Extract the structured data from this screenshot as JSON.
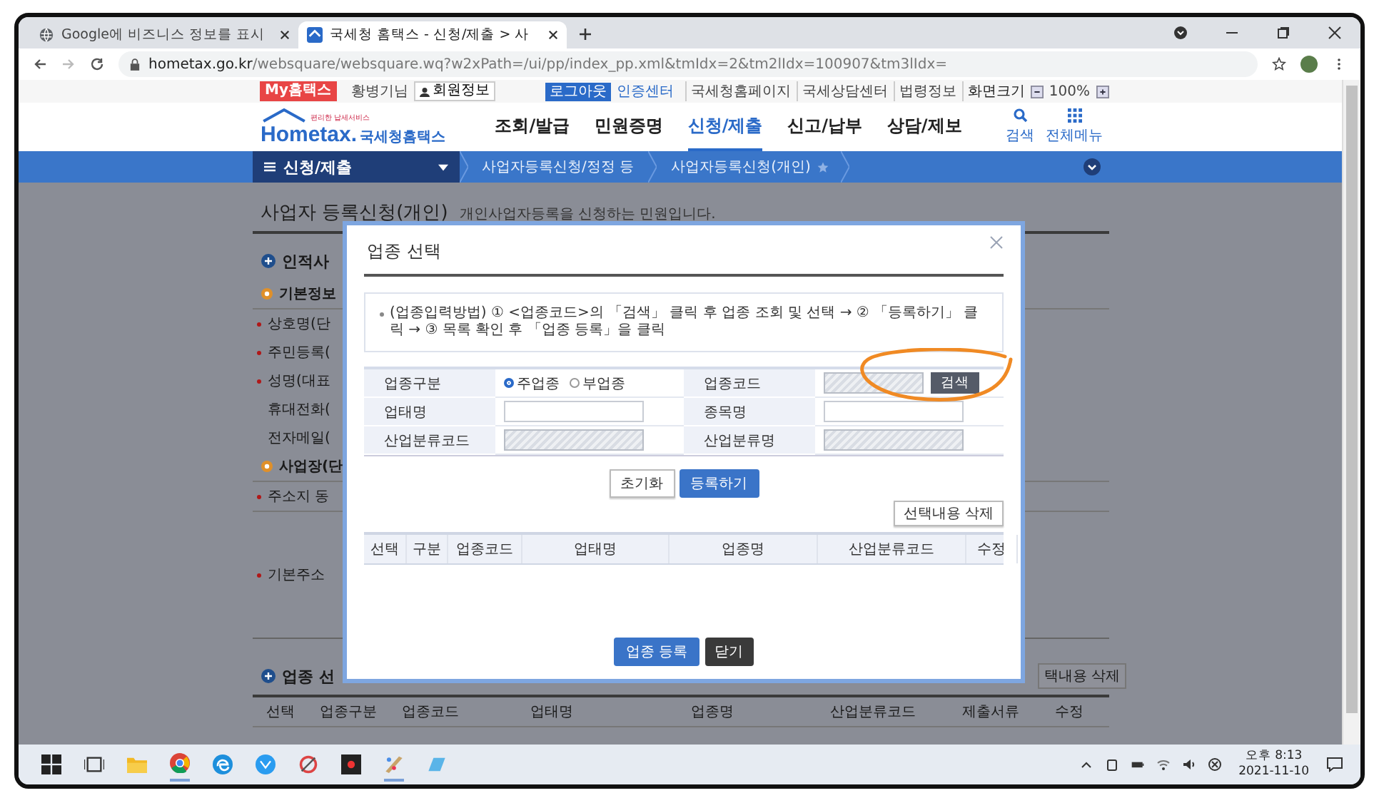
{
  "browser": {
    "tabs": [
      {
        "title": "Google에 비즈니스 정보를 표시",
        "selected": false
      },
      {
        "title": "국세청 홈택스 - 신청/제출 > 사",
        "selected": true
      }
    ],
    "url_host": "hometax.go.kr",
    "url_path": "/websquare/websquare.wq?w2xPath=/ui/pp/index_pp.xml&tmIdx=2&tm2lIdx=100907&tm3lIdx="
  },
  "top_bar": {
    "my_button": "My홈택스",
    "user_name": "황병기님",
    "member_info": "회원정보",
    "logout": "로그아웃",
    "cert_center": "인증센터",
    "links": [
      "국세청홈페이지",
      "국세상담센터",
      "법령정보"
    ],
    "zoom_label": "화면크기",
    "zoom_value": "100%"
  },
  "header": {
    "logo_tagline": "편리한 납세서비스",
    "logo_text": "Hometax.",
    "logo_name": "국세청홈택스",
    "menu": [
      {
        "label": "조회/발급",
        "selected": false
      },
      {
        "label": "민원증명",
        "selected": false
      },
      {
        "label": "신청/제출",
        "selected": true
      },
      {
        "label": "신고/납부",
        "selected": false
      },
      {
        "label": "상담/제보",
        "selected": false
      }
    ],
    "search": "검색",
    "all_menu": "전체메뉴"
  },
  "breadcrumb": {
    "menu": "신청/제출",
    "items": [
      "사업자등록신청/정정 등",
      "사업자등록신청(개인)"
    ]
  },
  "page": {
    "title": "사업자 등록신청(개인)",
    "subtitle": "개인사업자등록을 신청하는 민원입니다.",
    "rows": [
      {
        "kind": "section",
        "label": "인적사"
      },
      {
        "kind": "group",
        "label": "기본정보"
      },
      {
        "kind": "field",
        "label": "상호명(단",
        "required": true
      },
      {
        "kind": "field",
        "label": "주민등록(",
        "required": true
      },
      {
        "kind": "field",
        "label": "성명(대표",
        "required": true
      },
      {
        "kind": "field",
        "label": "휴대전화(",
        "required": false
      },
      {
        "kind": "field",
        "label": "전자메일(",
        "required": false
      },
      {
        "kind": "group",
        "label": "사업장(단"
      },
      {
        "kind": "field",
        "label": "주소지 동",
        "required": true
      },
      {
        "kind": "tall",
        "label": "기본주소",
        "required": true
      }
    ],
    "bottom_section": "업종 선",
    "bottom_button": "택내용 삭제",
    "bottom_columns": [
      "선택",
      "업종구분",
      "업종코드",
      "업태명",
      "업종명",
      "산업분류코드",
      "제출서류",
      "수정"
    ]
  },
  "modal": {
    "title": "업종 선택",
    "instructions": "(업종입력방법) ① <업종코드>의 「검색」 클릭 후 업종 조회 및 선택 → ② 「등록하기」 클릭 → ③ 목록 확인 후 「업종 등록」을 클릭",
    "form": [
      {
        "label": "업종구분",
        "kind": "radio",
        "options": [
          {
            "label": "주업종",
            "selected": true
          },
          {
            "label": "부업종",
            "selected": false
          }
        ]
      },
      {
        "label": "업종코드",
        "kind": "search",
        "disabled": true,
        "button": "검색"
      },
      {
        "label": "업태명",
        "kind": "input",
        "disabled": false
      },
      {
        "label": "종목명",
        "kind": "input",
        "disabled": false
      },
      {
        "label": "산업분류코드",
        "kind": "input",
        "disabled": true
      },
      {
        "label": "산업분류명",
        "kind": "input",
        "disabled": true
      }
    ],
    "reset_button": "초기화",
    "add_button": "등록하기",
    "delete_button": "선택내용 삭제",
    "columns": [
      "선택",
      "구분",
      "업종코드",
      "업태명",
      "업종명",
      "산업분류코드",
      "수정"
    ],
    "register_button": "업종 등록",
    "close_button": "닫기"
  },
  "taskbar": {
    "time": "오후 8:13",
    "date": "2021-11-10"
  }
}
